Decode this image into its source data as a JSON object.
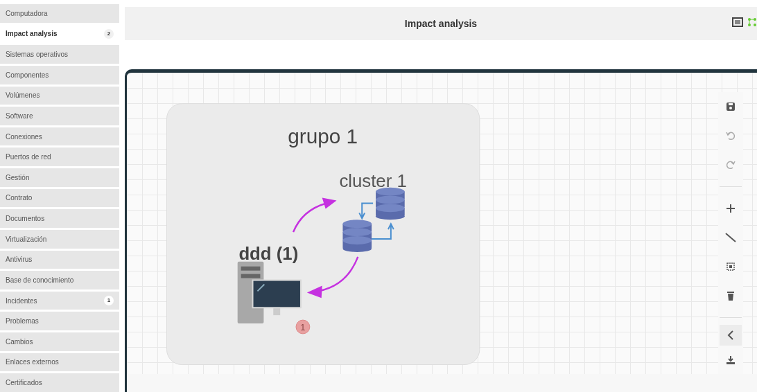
{
  "sidebar": {
    "items": [
      {
        "label": "Computadora",
        "selected": false
      },
      {
        "label": "Impact analysis",
        "selected": true,
        "badge": "2"
      },
      {
        "label": "Sistemas operativos",
        "selected": false
      },
      {
        "label": "Componentes",
        "selected": false
      },
      {
        "label": "Volúmenes",
        "selected": false
      },
      {
        "label": "Software",
        "selected": false
      },
      {
        "label": "Conexiones",
        "selected": false
      },
      {
        "label": "Puertos de red",
        "selected": false
      },
      {
        "label": "Gestión",
        "selected": false
      },
      {
        "label": "Contrato",
        "selected": false
      },
      {
        "label": "Documentos",
        "selected": false
      },
      {
        "label": "Virtualización",
        "selected": false
      },
      {
        "label": "Antivirus",
        "selected": false
      },
      {
        "label": "Base de conocimiento",
        "selected": false
      },
      {
        "label": "Incidentes",
        "selected": false,
        "badge": "1"
      },
      {
        "label": "Problemas",
        "selected": false
      },
      {
        "label": "Cambios",
        "selected": false
      },
      {
        "label": "Enlaces externos",
        "selected": false
      },
      {
        "label": "Certificados",
        "selected": false
      }
    ]
  },
  "header": {
    "title": "Impact analysis"
  },
  "diagram": {
    "group": {
      "label": "grupo 1"
    },
    "cluster": {
      "label": "cluster 1"
    },
    "node": {
      "label": "ddd (1)",
      "badge": "1"
    }
  },
  "toolbar": [
    {
      "kind": "save",
      "disabled": false
    },
    {
      "kind": "undo",
      "disabled": true
    },
    {
      "kind": "redo",
      "disabled": true
    },
    {
      "kind": "separator"
    },
    {
      "kind": "add",
      "disabled": false
    },
    {
      "kind": "line",
      "disabled": false
    },
    {
      "kind": "select",
      "disabled": false
    },
    {
      "kind": "delete",
      "disabled": false
    },
    {
      "kind": "separator"
    },
    {
      "kind": "collapse",
      "disabled": false
    },
    {
      "kind": "download",
      "disabled": false
    }
  ]
}
